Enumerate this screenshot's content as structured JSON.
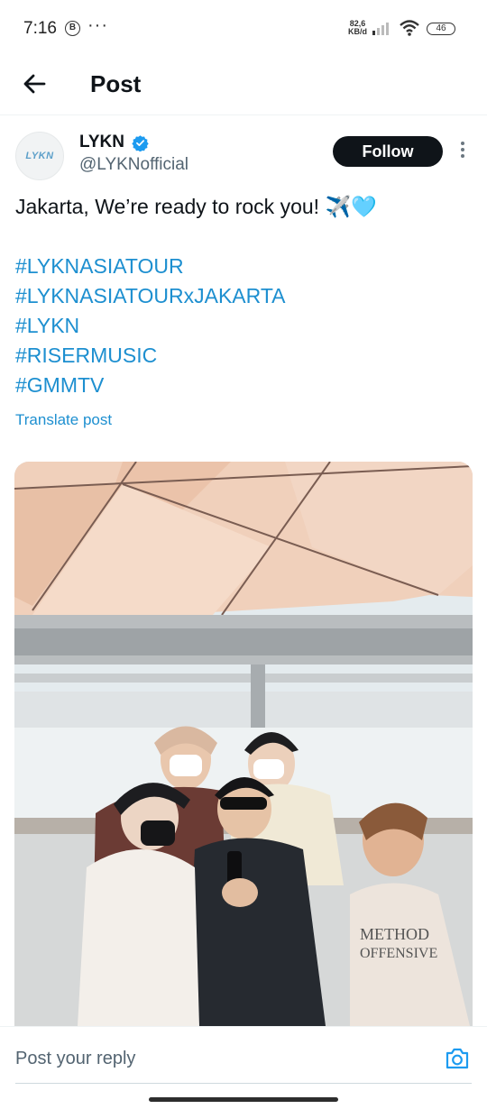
{
  "status_bar": {
    "time": "7:16",
    "b_icon": "B",
    "dots": "···",
    "speed_top": "82,6",
    "speed_bottom": "KB/d",
    "battery": "46"
  },
  "header": {
    "title": "Post",
    "back_icon": "arrow-left-icon"
  },
  "author": {
    "name": "LYKN",
    "handle": "@LYKNofficial",
    "avatar_text": "LYKN",
    "verified": true,
    "follow_label": "Follow"
  },
  "post": {
    "text": "Jakarta, We’re ready to rock you! ✈️🩵",
    "hashtags": [
      "#LYKNASIATOUR",
      "#LYKNASIATOURxJAKARTA",
      "#LYKN",
      "#RISERMUSIC",
      "#GMMTV"
    ],
    "translate_label": "Translate post",
    "photo_shirt_text": "METHOD OFFENSIVE"
  },
  "reply": {
    "placeholder": "Post your reply",
    "camera_icon": "camera-icon"
  },
  "colors": {
    "accent": "#1d8fd0",
    "text": "#0f1419",
    "secondary": "#536471",
    "follow_bg": "#0f1419"
  }
}
